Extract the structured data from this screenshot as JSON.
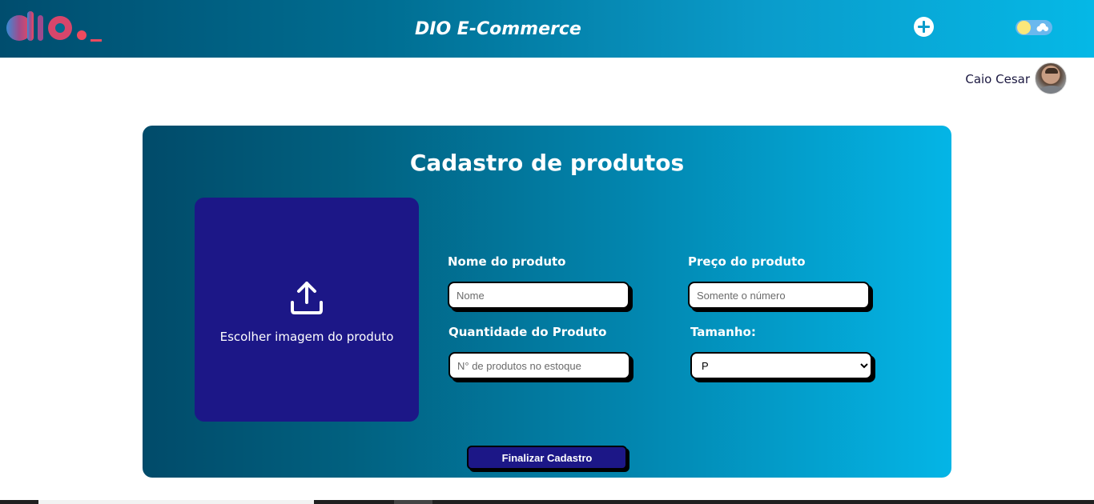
{
  "header": {
    "title": "DIO E-Commerce",
    "logo_text": "dio._",
    "add_icon": "plus-circle-icon",
    "theme_toggle_icon": "sun-cloud-toggle-icon"
  },
  "user": {
    "name": "Caio Cesar",
    "avatar_icon": "user-avatar"
  },
  "form": {
    "title": "Cadastro de produtos",
    "upload": {
      "label": "Escolher imagem do produto",
      "icon": "upload-icon"
    },
    "fields": {
      "name": {
        "label": "Nome do produto",
        "placeholder": "Nome"
      },
      "price": {
        "label": "Preço do produto",
        "placeholder": "Somente o número"
      },
      "quantity": {
        "label": "Quantidade do Produto",
        "placeholder": "N° de produtos no estoque"
      },
      "size": {
        "label": "Tamanho:",
        "selected": "P"
      }
    },
    "submit_label": "Finalizar Cadastro"
  },
  "colors": {
    "header_start": "#004d6e",
    "header_end": "#05b8e6",
    "card_start": "#014b6a",
    "card_end": "#04b5e6",
    "upload_bg": "#1c1787",
    "button_bg": "#1c1787"
  }
}
